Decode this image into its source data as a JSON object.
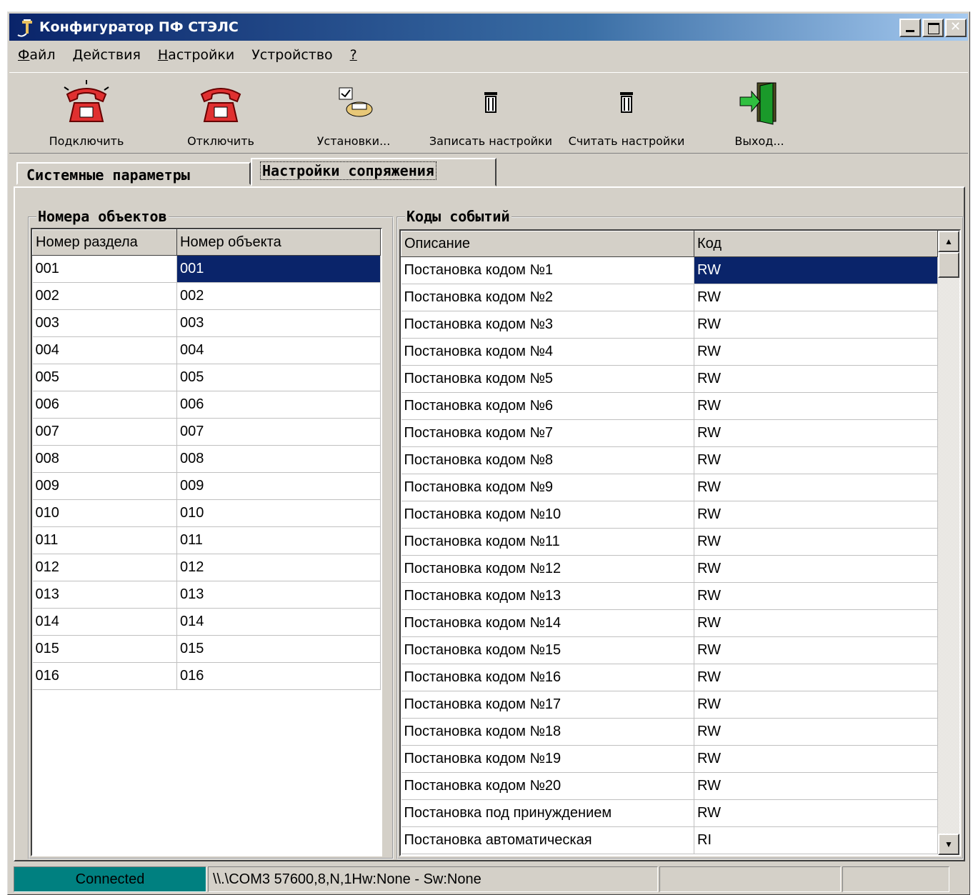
{
  "window": {
    "title": "Конфигуратор ПФ СТЭЛС"
  },
  "menu": [
    {
      "label": "Файл",
      "u": "Ф",
      "rest": "айл"
    },
    {
      "label": "Действия",
      "u": "Д",
      "rest": "ействия"
    },
    {
      "label": "Настройки",
      "u": "Н",
      "rest": "астройки"
    },
    {
      "label": "Устройство",
      "u": "",
      "rest": "Устройство"
    },
    {
      "label": "?",
      "u": "?",
      "rest": ""
    }
  ],
  "toolbar": {
    "connect": "Подключить",
    "disconnect": "Отключить",
    "settings": "Установки...",
    "write": "Записать настройки",
    "read": "Считать настройки",
    "exit": "Выход..."
  },
  "tabs": {
    "system": "Системные параметры",
    "interface": "Настройки сопряжения"
  },
  "objects": {
    "title": "Номера объектов",
    "headers": [
      "Номер раздела",
      "Номер объекта"
    ],
    "rows": [
      [
        "001",
        "001"
      ],
      [
        "002",
        "002"
      ],
      [
        "003",
        "003"
      ],
      [
        "004",
        "004"
      ],
      [
        "005",
        "005"
      ],
      [
        "006",
        "006"
      ],
      [
        "007",
        "007"
      ],
      [
        "008",
        "008"
      ],
      [
        "009",
        "009"
      ],
      [
        "010",
        "010"
      ],
      [
        "011",
        "011"
      ],
      [
        "012",
        "012"
      ],
      [
        "013",
        "013"
      ],
      [
        "014",
        "014"
      ],
      [
        "015",
        "015"
      ],
      [
        "016",
        "016"
      ]
    ]
  },
  "events": {
    "title": "Коды событий",
    "headers": [
      "Описание",
      "Код"
    ],
    "rows": [
      [
        "Постановка кодом №1",
        "RW"
      ],
      [
        "Постановка кодом №2",
        "RW"
      ],
      [
        "Постановка кодом №3",
        "RW"
      ],
      [
        "Постановка кодом №4",
        "RW"
      ],
      [
        "Постановка кодом №5",
        "RW"
      ],
      [
        "Постановка кодом №6",
        "RW"
      ],
      [
        "Постановка кодом №7",
        "RW"
      ],
      [
        "Постановка кодом №8",
        "RW"
      ],
      [
        "Постановка кодом №9",
        "RW"
      ],
      [
        "Постановка кодом №10",
        "RW"
      ],
      [
        "Постановка кодом №11",
        "RW"
      ],
      [
        "Постановка кодом №12",
        "RW"
      ],
      [
        "Постановка кодом №13",
        "RW"
      ],
      [
        "Постановка кодом №14",
        "RW"
      ],
      [
        "Постановка кодом №15",
        "RW"
      ],
      [
        "Постановка кодом №16",
        "RW"
      ],
      [
        "Постановка кодом №17",
        "RW"
      ],
      [
        "Постановка кодом №18",
        "RW"
      ],
      [
        "Постановка кодом №19",
        "RW"
      ],
      [
        "Постановка кодом №20",
        "RW"
      ],
      [
        "Постановка под принуждением",
        "RW"
      ],
      [
        "Постановка автоматическая",
        "RI"
      ]
    ]
  },
  "status": {
    "connection": "Connected",
    "port": "\\\\.\\COM3  57600,8,N,1Hw:None - Sw:None"
  },
  "colors": {
    "selection": "#0a246a",
    "status_connected": "#008080"
  }
}
